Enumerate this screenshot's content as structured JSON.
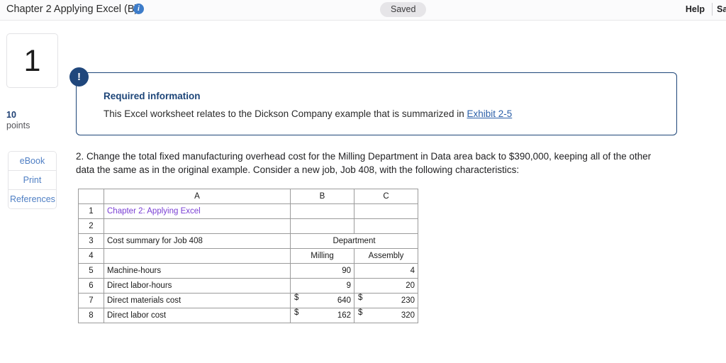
{
  "topbar": {
    "title": "Chapter 2 Applying Excel (B)",
    "info_icon": "info-icon",
    "saved_label": "Saved",
    "help_label": "Help",
    "save_exit_label": "Save & Exit"
  },
  "rail": {
    "question_number": "1",
    "points_value": "10",
    "points_label": "points",
    "buttons": [
      {
        "label": "eBook",
        "name": "ebook-button"
      },
      {
        "label": "Print",
        "name": "print-button"
      },
      {
        "label": "References",
        "name": "references-button"
      }
    ]
  },
  "callout": {
    "badge": "!",
    "title": "Required information",
    "body_before": "This Excel worksheet relates to the Dickson Company example that is summarized in ",
    "link": "Exhibit 2-5"
  },
  "question": {
    "text": "2. Change the total fixed manufacturing overhead cost for the Milling Department in Data area back to $390,000, keeping all of the other data the same as in the original example. Consider a new job, Job 408, with the following characteristics:"
  },
  "spreadsheet": {
    "column_headers": [
      "",
      "A",
      "B",
      "C"
    ],
    "rows": [
      {
        "num": "1",
        "a": "Chapter 2: Applying Excel",
        "b": "",
        "c": ""
      },
      {
        "num": "2",
        "a": "",
        "b": "",
        "c": ""
      },
      {
        "num": "3",
        "a": "Cost summary for Job 408",
        "span": "Department"
      },
      {
        "num": "4",
        "a": "",
        "b": "Milling",
        "c": "Assembly"
      },
      {
        "num": "5",
        "a": "Machine-hours",
        "b": "90",
        "c": "4"
      },
      {
        "num": "6",
        "a": "Direct labor-hours",
        "b": "9",
        "c": "20"
      },
      {
        "num": "7",
        "a": "Direct materials cost",
        "b_sym": "$",
        "b": "640",
        "c_sym": "$",
        "c": "230"
      },
      {
        "num": "8",
        "a": "Direct labor cost",
        "b_sym": "$",
        "b": "162",
        "c_sym": "$",
        "c": "320"
      }
    ]
  },
  "colors": {
    "accent_blue": "#1d4578",
    "link_blue": "#2b5fa8",
    "sheet_title_purple": "#7a3fd4",
    "rail_button_blue": "#4f7fc4"
  }
}
